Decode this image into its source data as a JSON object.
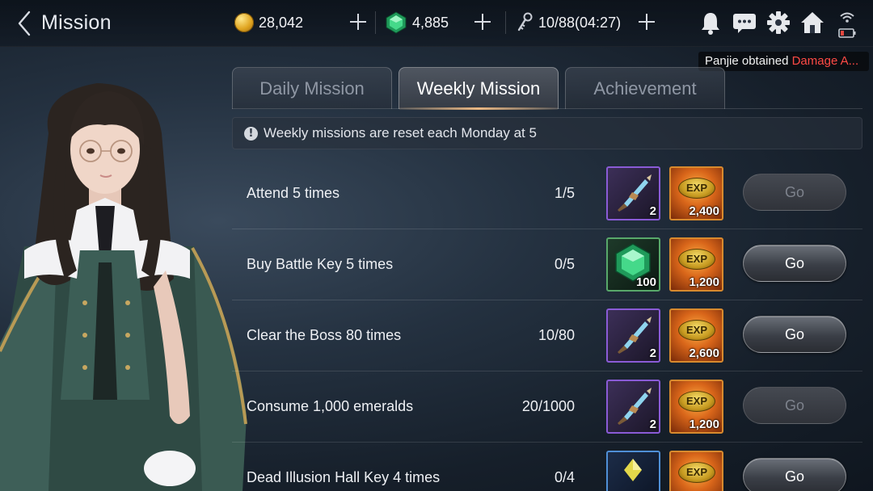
{
  "header": {
    "title": "Mission",
    "gold": "28,042",
    "emerald": "4,885",
    "battle_key": "10/88(04:27)"
  },
  "notification": {
    "player": "Panjie",
    "text": " obtained ",
    "item": "Damage A..."
  },
  "tabs": [
    {
      "label": "Daily Mission",
      "active": false
    },
    {
      "label": "Weekly Mission",
      "active": true
    },
    {
      "label": "Achievement",
      "active": false
    }
  ],
  "notice": "Weekly missions are reset each Monday at 5",
  "missions": [
    {
      "name": "Attend 5 times",
      "progress": "1/5",
      "item_qty": "2",
      "exp": "2,400",
      "button": "Go",
      "enabled": false
    },
    {
      "name": "Buy Battle Key 5 times",
      "progress": "0/5",
      "item_qty": "100",
      "exp": "1,200",
      "button": "Go",
      "enabled": true
    },
    {
      "name": "Clear the Boss 80 times",
      "progress": "10/80",
      "item_qty": "2",
      "exp": "2,600",
      "button": "Go",
      "enabled": true
    },
    {
      "name": "Consume 1,000 emeralds",
      "progress": "20/1000",
      "item_qty": "2",
      "exp": "1,200",
      "button": "Go",
      "enabled": false
    },
    {
      "name": "Dead Illusion Hall Key 4 times",
      "progress": "0/4",
      "item_qty": "",
      "exp": "",
      "button": "Go",
      "enabled": true
    }
  ],
  "exp_label": "EXP",
  "colors": {
    "notification_item": "#ff4a45",
    "active_tab_underline": "#e8b27a",
    "rare_frame": "#8a5bd6",
    "emerald_frame": "#58a86a",
    "exp_frame": "#d88a2e"
  }
}
